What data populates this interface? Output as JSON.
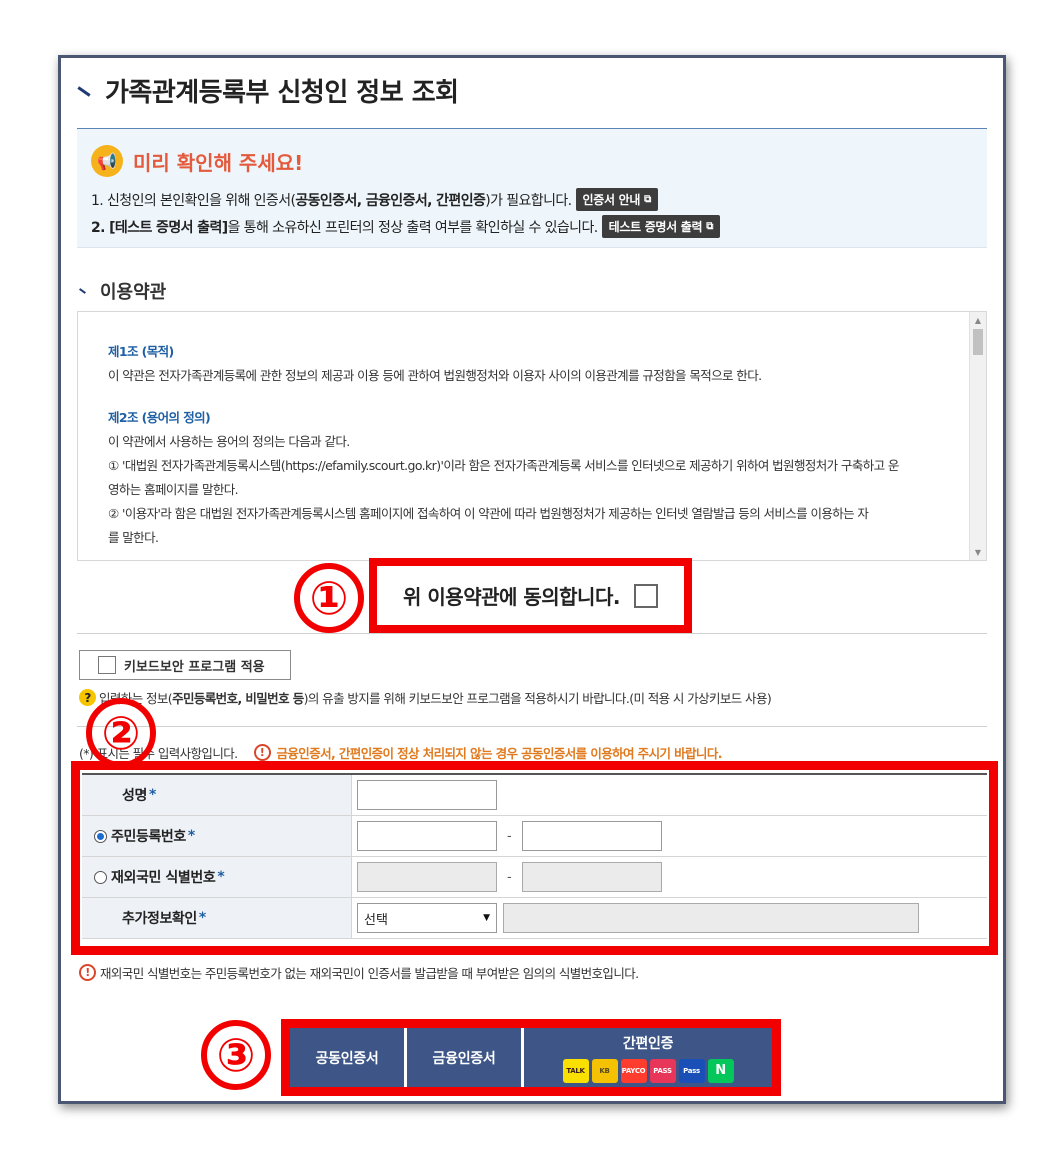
{
  "page": {
    "title": "가족관계등록부 신청인 정보 조회"
  },
  "notice": {
    "title": "미리 확인해 주세요!",
    "line1": {
      "prefix": "1. 신청인의 본인확인을 위해 인증서(",
      "bold": "공동인증서, 금융인증서, 간편인증",
      "suffix": ")가 필요합니다.",
      "button": "인증서 안내"
    },
    "line2": {
      "bold": "2. [테스트 증명서 출력]",
      "suffix": "을 통해 소유하신 프린터의 정상 출력 여부를 확인하실 수 있습니다.",
      "button": "테스트 증명서 출력"
    }
  },
  "terms": {
    "section_title": "이용약관",
    "article1_title": "제1조 (목적)",
    "article1_text": "이 약관은 전자가족관계등록에 관한 정보의 제공과 이용 등에 관하여 법원행정처와 이용자 사이의 이용관계를 규정함을 목적으로 한다.",
    "article2_title": "제2조 (용어의 정의)",
    "article2_intro": "이 약관에서 사용하는 용어의 정의는 다음과 같다.",
    "article2_item1a": "① '대법원 전자가족관계등록시스템(https://efamily.scourt.go.kr)'이라 함은 전자가족관계등록 서비스를 인터넷으로 제공하기 위하여 법원행정처가 구축하고 운",
    "article2_item1b": "영하는 홈페이지를 말한다.",
    "article2_item2a": "② '이용자'라 함은 대법원 전자가족관계등록시스템 홈페이지에 접속하여 이 약관에 따라 법원행정처가 제공하는 인터넷 열람발급 등의 서비스를 이용하는 자",
    "article2_item2b": "를 말한다.",
    "agree_label": "위 이용약관에 동의합니다."
  },
  "keyboard": {
    "button_label": "키보드보안 프로그램 적용",
    "note_prefix": "입력하는 정보(",
    "note_bold": "주민등록번호, 비밀번호 등",
    "note_suffix": ")의 유출 방지를 위해 키보드보안 프로그램을 적용하시기 바랍니다.(미 적용 시 가상키보드 사용)"
  },
  "form": {
    "required_note": "(*) 표시는 필수 입력사항입니다.",
    "required_warning": "금융인증서, 간편인증이 정상 처리되지 않는 경우 공동인증서를 이용하여 주시기 바랍니다.",
    "star": "*",
    "name_label": "성명",
    "rrn_label": "주민등록번호",
    "foreign_label": "재외국민 식별번호",
    "extra_label": "추가정보확인",
    "dash": "-",
    "select_value": "선택",
    "foreign_note": "재외국민 식별번호는 주민등록번호가 없는 재외국민이 인증서를 발급받을 때 부여받은 임의의 식별번호입니다."
  },
  "auth": {
    "joint_label": "공동인증서",
    "financial_label": "금융인증서",
    "simple_label": "간편인증",
    "logos": [
      "TALK",
      "KB",
      "PAYCO",
      "PASS",
      "Pass",
      "N"
    ]
  },
  "annotations": {
    "n1": "①",
    "n2": "②",
    "n3": "③"
  },
  "colors": {
    "highlight_red": "#f20000",
    "navy": "#3d5687",
    "notice_title": "#e35a3c",
    "warning_orange": "#e07a1f"
  }
}
